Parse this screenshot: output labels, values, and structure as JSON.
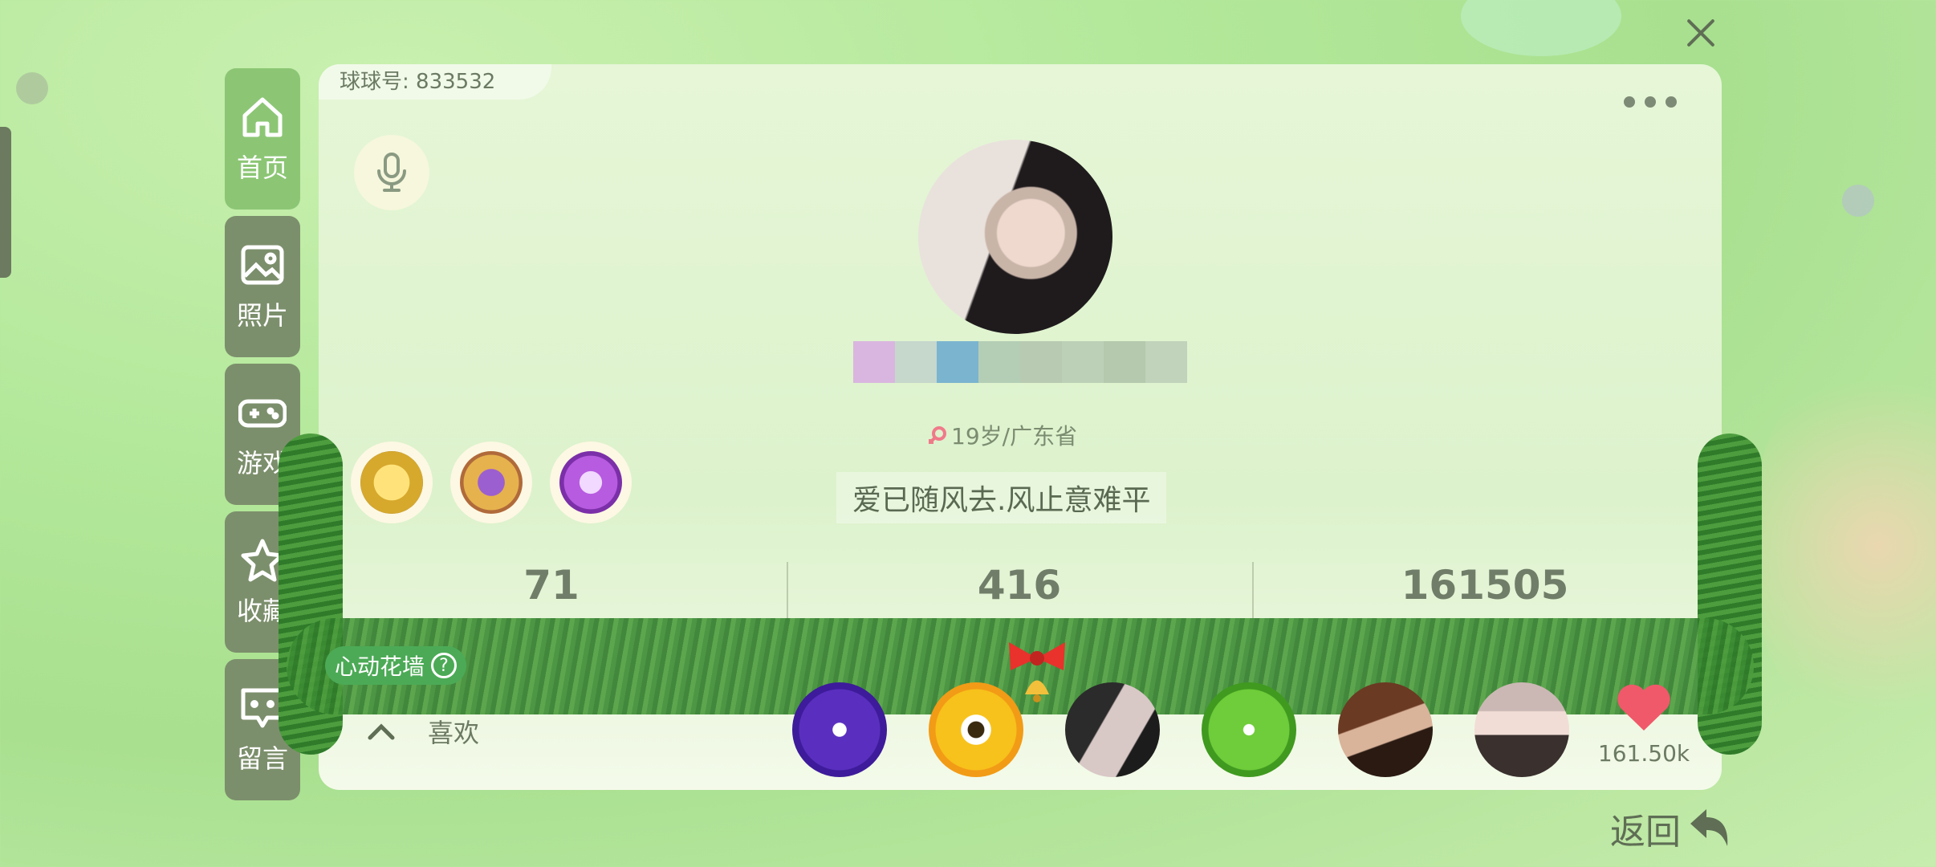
{
  "profile": {
    "id_label": "球球号: 833532",
    "info": "19岁/广东省",
    "signature": "爱已随风去.风止意难平",
    "stats": [
      {
        "value": "71"
      },
      {
        "value": "416"
      },
      {
        "value": "161505"
      }
    ],
    "flower_wall": {
      "label": "心动花墙",
      "help": "?"
    },
    "likes": {
      "label": "喜欢",
      "count": "161.50k"
    }
  },
  "sidebar": {
    "items": [
      {
        "label": "首页",
        "icon": "home-icon",
        "active": true
      },
      {
        "label": "照片",
        "icon": "photo-icon"
      },
      {
        "label": "游戏",
        "icon": "gamepad-icon"
      },
      {
        "label": "收藏",
        "icon": "star-icon"
      },
      {
        "label": "留言",
        "icon": "message-icon"
      }
    ]
  },
  "footer": {
    "back_label": "返回"
  },
  "colors": {
    "accent_green": "#8cc675",
    "sidebar_inactive": "#7c8f6c",
    "heart": "#f0596a",
    "flower_wall_bg": "#4caa56"
  }
}
